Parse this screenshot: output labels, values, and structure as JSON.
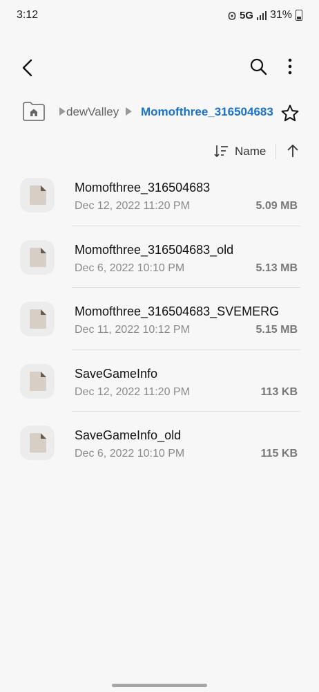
{
  "status_bar": {
    "time": "3:12",
    "network": "5G",
    "battery": "31%"
  },
  "app_bar": {
    "back_icon": "chevron-left-icon",
    "search_icon": "search-icon",
    "more_icon": "more-vert-icon"
  },
  "breadcrumb": {
    "home_icon": "home-folder-icon",
    "items": [
      {
        "label": "dewValley"
      },
      {
        "label": "Momofthree_316504683"
      }
    ],
    "active_color": "#1a73c8",
    "favorite_icon": "star-outline-icon"
  },
  "sort": {
    "label": "Name",
    "order_icon": "arrow-up-icon"
  },
  "files": [
    {
      "name": "Momofthree_316504683",
      "date": "Dec 12, 2022 11:20 PM",
      "size": "5.09 MB"
    },
    {
      "name": "Momofthree_316504683_old",
      "date": "Dec 6, 2022 10:10 PM",
      "size": "5.13 MB"
    },
    {
      "name": "Momofthree_316504683_SVEMERG",
      "date": "Dec 11, 2022 10:12 PM",
      "size": "5.15 MB"
    },
    {
      "name": "SaveGameInfo",
      "date": "Dec 12, 2022 11:20 PM",
      "size": "113 KB"
    },
    {
      "name": "SaveGameInfo_old",
      "date": "Dec 6, 2022 10:10 PM",
      "size": "115 KB"
    }
  ]
}
